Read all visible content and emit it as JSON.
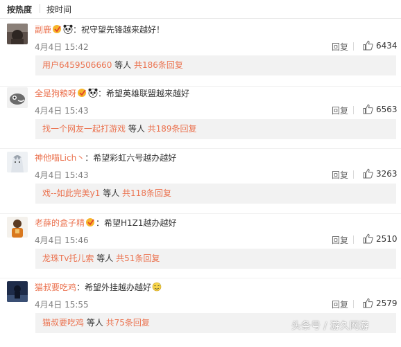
{
  "sort": {
    "hot_label": "按热度",
    "time_label": "按时间"
  },
  "comments": [
    {
      "user": "副鹿",
      "vip": true,
      "panda": true,
      "text": "：祝守望先锋越来越好！",
      "time": "4月4日 15:42",
      "reply": "回复",
      "likes": "6434",
      "sub": {
        "user": "用户6459506660",
        "etc": " 等人 ",
        "count": "共186条回复"
      }
    },
    {
      "user": "全是狗粮呀",
      "vip": true,
      "panda": true,
      "text": "：希望英雄联盟越来越好",
      "time": "4月4日 15:43",
      "reply": "回复",
      "likes": "6563",
      "sub": {
        "user": "找一个网友一起打游戏",
        "etc": " 等人 ",
        "count": "共189条回复"
      }
    },
    {
      "user": "神他喵Lich丶",
      "vip": false,
      "panda": false,
      "text": "：希望彩虹六号越办越好",
      "time": "4月4日 15:43",
      "reply": "回复",
      "likes": "3263",
      "sub": {
        "user": "戏--如此完美y1",
        "etc": " 等人 ",
        "count": "共118条回复"
      }
    },
    {
      "user": "老薛的盒子精",
      "vip": true,
      "panda": false,
      "text": "：希望H1Z1越办越好",
      "time": "4月4日 15:46",
      "reply": "回复",
      "likes": "2510",
      "sub": {
        "user": "龙珠Tv托儿索",
        "etc": " 等人 ",
        "count": "共51条回复"
      }
    },
    {
      "user": "猫叔要吃鸡",
      "vip": false,
      "panda": false,
      "text": "：希望外挂越办越好",
      "time": "4月4日 15:55",
      "reply": "回复",
      "likes": "2579",
      "sub": {
        "user": "猫叔要吃鸡",
        "etc": " 等人 ",
        "count": "共75条回复"
      }
    }
  ],
  "watermark": "头条号 / 游久网游",
  "colors": {
    "username": "#eb7350",
    "subbox": "#f2f2f2",
    "time": "#808080"
  }
}
